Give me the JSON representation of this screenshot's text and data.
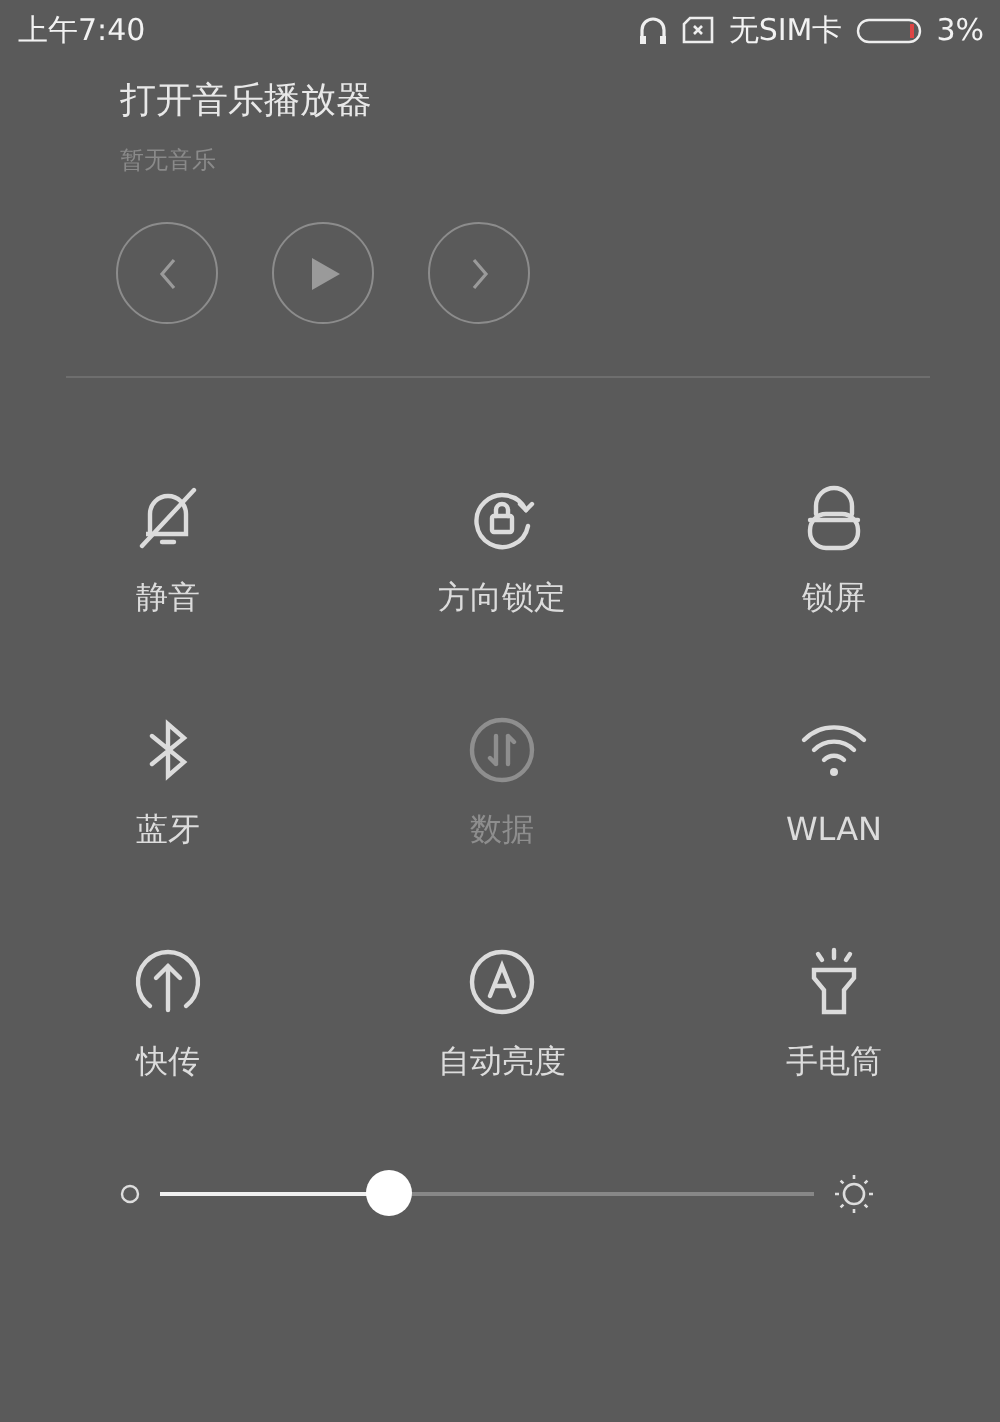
{
  "status_bar": {
    "time": "上午7:40",
    "carrier": "无SIM卡",
    "battery": "3%"
  },
  "music": {
    "title": "打开音乐播放器",
    "subtitle": "暂无音乐"
  },
  "toggles": [
    {
      "label": "静音",
      "disabled": false
    },
    {
      "label": "方向锁定",
      "disabled": false
    },
    {
      "label": "锁屏",
      "disabled": false
    },
    {
      "label": "蓝牙",
      "disabled": false
    },
    {
      "label": "数据",
      "disabled": true
    },
    {
      "label": "WLAN",
      "disabled": false
    },
    {
      "label": "快传",
      "disabled": false
    },
    {
      "label": "自动亮度",
      "disabled": false
    },
    {
      "label": "手电筒",
      "disabled": false
    }
  ],
  "brightness": {
    "level": 0.35
  }
}
